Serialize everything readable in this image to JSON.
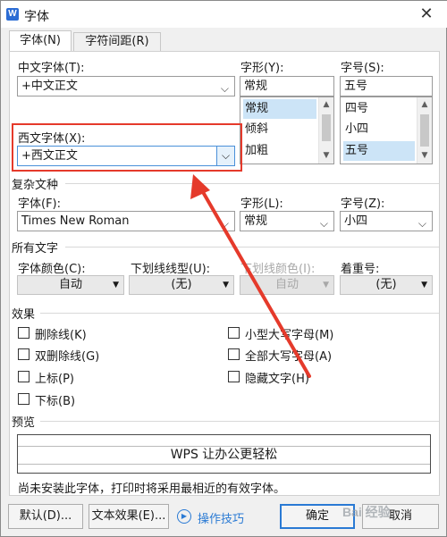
{
  "window": {
    "title": "字体",
    "app_icon": "W",
    "close_glyph": "✕"
  },
  "tabs": [
    {
      "label": "字体(N)",
      "active": true
    },
    {
      "label": "字符间距(R)",
      "active": false
    }
  ],
  "chinese_font": {
    "label": "中文字体(T):",
    "value": "+中文正文",
    "style_label": "字形(Y):",
    "style_value": "常规",
    "style_options": [
      "常规",
      "倾斜",
      "加粗"
    ],
    "size_label": "字号(S):",
    "size_value": "五号",
    "size_options": [
      "四号",
      "小四",
      "五号"
    ]
  },
  "western_font": {
    "label": "西文字体(X):",
    "value": "+西文正文"
  },
  "complex": {
    "section_label": "复杂文种",
    "font_label": "字体(F):",
    "font_value": "Times New Roman",
    "style_label": "字形(L):",
    "style_value": "常规",
    "size_label": "字号(Z):",
    "size_value": "小四"
  },
  "all_text": {
    "section_label": "所有文字",
    "color_label": "字体颜色(C):",
    "color_value": "自动",
    "underline_label": "下划线线型(U):",
    "underline_value": "(无)",
    "underline_color_label": "下划线颜色(I):",
    "underline_color_value": "自动",
    "emphasis_label": "着重号:",
    "emphasis_value": "(无)"
  },
  "effects": {
    "section_label": "效果",
    "left": [
      "删除线(K)",
      "双删除线(G)",
      "上标(P)",
      "下标(B)"
    ],
    "right": [
      "小型大写字母(M)",
      "全部大写字母(A)",
      "隐藏文字(H)"
    ]
  },
  "preview": {
    "section_label": "预览",
    "sample_text": "WPS 让办公更轻松",
    "note": "尚未安装此字体，打印时将采用最相近的有效字体。"
  },
  "buttons": {
    "default": "默认(D)...",
    "text_effects": "文本效果(E)...",
    "tips": "操作技巧",
    "ok": "确定",
    "cancel": "取消"
  },
  "watermark": "Bai 经验",
  "colors": {
    "highlight": "#e53a2b",
    "accent": "#2a7ad4"
  }
}
